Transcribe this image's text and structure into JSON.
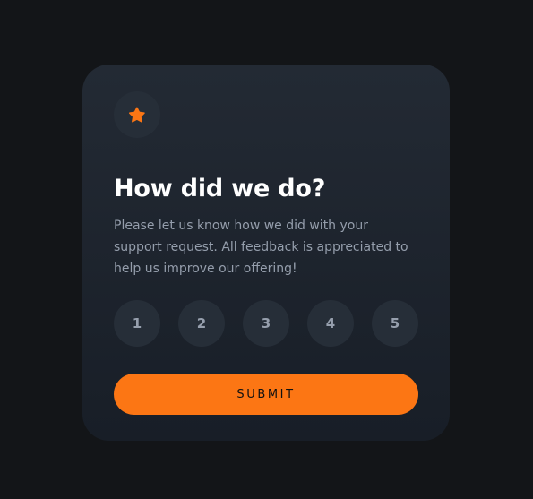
{
  "card": {
    "icon": "star-icon",
    "title": "How did we do?",
    "description": "Please let us know how we did with your support request. All feedback is appreciated to help us improve our offering!",
    "ratings": [
      "1",
      "2",
      "3",
      "4",
      "5"
    ],
    "submit_label": "SUBMIT"
  },
  "colors": {
    "background": "#131518",
    "card_top": "#232a34",
    "card_bottom": "#181e27",
    "accent": "#fc7614",
    "circle": "#262e38",
    "muted_text": "#959eac"
  }
}
